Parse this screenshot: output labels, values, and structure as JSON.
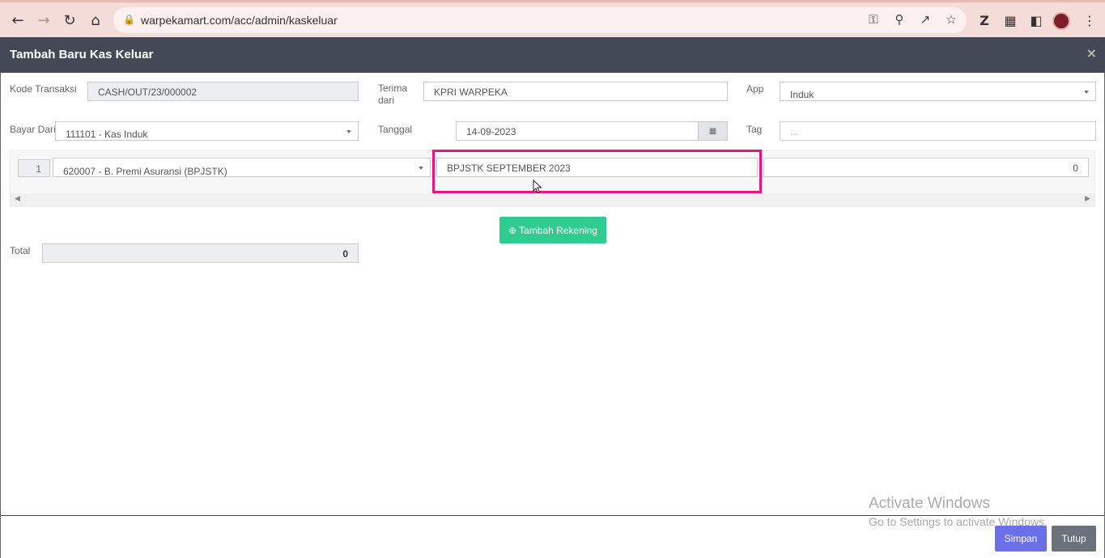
{
  "browser": {
    "url": "warpekamart.com/acc/admin/kaskeluar",
    "back_icon": "arrow-left-icon",
    "forward_icon": "arrow-right-icon",
    "reload_icon": "reload-icon",
    "home_icon": "home-icon"
  },
  "modal": {
    "title": "Tambah Baru Kas Keluar",
    "close_label": "×"
  },
  "form": {
    "kode_transaksi_label": "Kode Transaksi",
    "kode_transaksi_value": "CASH/OUT/23/000002",
    "terima_dari_label_1": "Terima",
    "terima_dari_label_2": "dari",
    "terima_dari_value": "KPRI WARPEKA",
    "app_label": "App",
    "app_value": "Induk",
    "bayar_dari_label": "Bayar Dari",
    "bayar_dari_value": "111101 - Kas Induk",
    "tanggal_label": "Tanggal",
    "tanggal_value": "14-09-2023",
    "tag_label": "Tag",
    "tag_placeholder": "..."
  },
  "rows": [
    {
      "number": "1",
      "account": "620007 - B. Premi Asuransi (BPJSTK)",
      "description": "BPJSTK SEPTEMBER 2023",
      "amount": "0"
    }
  ],
  "actions": {
    "tambah_rekening_label": "Tambah Rekening",
    "simpan_label": "Simpan",
    "tutup_label": "Tutup"
  },
  "total": {
    "label": "Total",
    "value": "0"
  },
  "watermark": {
    "title": "Activate Windows",
    "subtitle": "Go to Settings to activate Windows."
  },
  "colors": {
    "header_bg": "#444a55",
    "highlight": "#e5167f",
    "tambah_button": "#2ecc8f",
    "simpan_button": "#6b6fe8",
    "tutup_button": "#6c727b"
  }
}
